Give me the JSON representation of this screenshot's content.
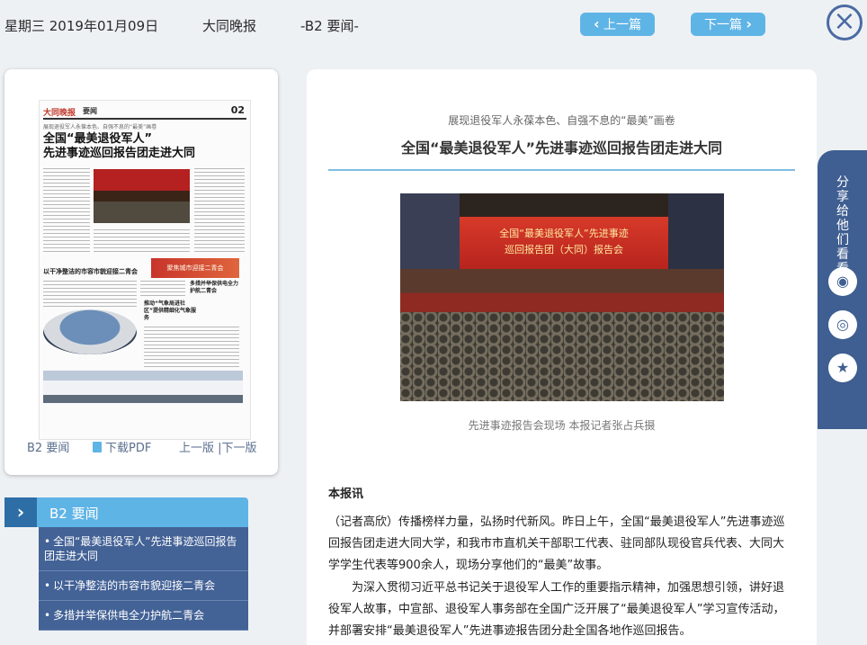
{
  "header": {
    "date": "星期三 2019年01月09日",
    "paper": "大同晚报",
    "section": "-B2 要闻-",
    "prev_label": "上一篇",
    "next_label": "下一篇",
    "close_icon": "close-icon"
  },
  "page_card": {
    "thumb": {
      "masthead": "大同晚报",
      "section": "要闻",
      "page_no": "02",
      "kicker": "展现退役军人永葆本色、自强不息的“最美”画卷",
      "headline_1": "全国“最美退役军人”",
      "headline_2": "先进事迹巡回报告团走进大同",
      "sub_headline": "以干净整洁的市容市貌迎接二青会",
      "banner_text": "聚焦城市迎接二青会",
      "side_headline": "多措并举保供电全力护航二青会",
      "side_headline_2": "推动“气象局进社区”提供精细化气象服务"
    },
    "edition_label": "B2 要闻",
    "pdf_label": "下载PDF",
    "pager_label": "上一版 |下一版"
  },
  "sections": {
    "title": "B2 要闻",
    "items": [
      "全国“最美退役军人”先进事迹巡回报告团走进大同",
      "以干净整洁的市容市貌迎接二青会",
      "多措并举保供电全力护航二青会"
    ]
  },
  "article": {
    "kicker": "展现退役军人永葆本色、自强不息的“最美”画卷",
    "title": "全国“最美退役军人”先进事迹巡回报告团走进大同",
    "photo_screen_line1": "全国“最美退役军人”先进事迹",
    "photo_screen_line2": "巡回报告团（大同）报告会",
    "caption": "先进事迹报告会现场 本报记者张占兵摄",
    "lead": "本报讯",
    "paragraphs": [
      "（记者高欣）传播榜样力量，弘扬时代新风。昨日上午，全国“最美退役军人”先进事迹巡回报告团走进大同大学，和我市市直机关干部职工代表、驻同部队现役官兵代表、大同大学学生代表等900余人，现场分享他们的“最美”故事。",
      "　　为深入贯彻习近平总书记关于退役军人工作的重要指示精神，加强思想引领，讲好退役军人故事，中宣部、退役军人事务部在全国广泛开展了“最美退役军人”学习宣传活动，并部署安排“最美退役军人”先进事迹报告团分赴全国各地作巡回报告。"
    ]
  },
  "share": {
    "label": "分享给他们看看",
    "icons": [
      "wechat-icon",
      "weibo-icon",
      "qzone-icon"
    ]
  }
}
